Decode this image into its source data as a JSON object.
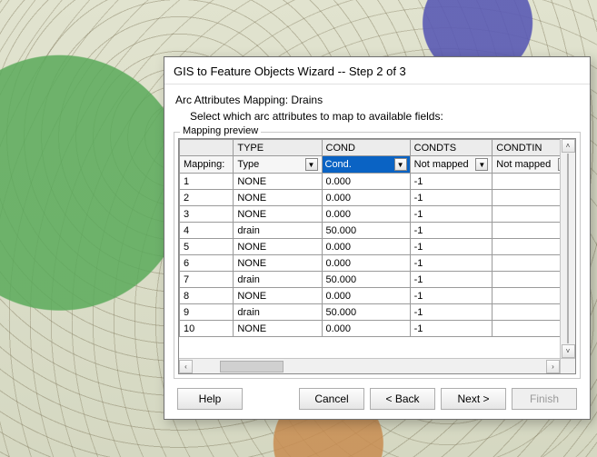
{
  "dialog": {
    "title": "GIS to Feature Objects Wizard -- Step 2 of 3",
    "section_label": "Arc Attributes Mapping:  Drains",
    "section_sub": "Select which arc attributes to map to available fields:",
    "fieldset_legend": "Mapping preview"
  },
  "columns": [
    "",
    "TYPE",
    "COND",
    "CONDTS",
    "CONDTIN"
  ],
  "mapping_row": {
    "label": "Mapping:",
    "cells": [
      {
        "value": "Type",
        "selected": false
      },
      {
        "value": "Cond.",
        "selected": true
      },
      {
        "value": "Not mapped",
        "selected": false
      },
      {
        "value": "Not mapped",
        "selected": false
      }
    ]
  },
  "rows": [
    {
      "n": "1",
      "type": "NONE",
      "cond": "0.000",
      "condts": "-1",
      "condtin": ""
    },
    {
      "n": "2",
      "type": "NONE",
      "cond": "0.000",
      "condts": "-1",
      "condtin": ""
    },
    {
      "n": "3",
      "type": "NONE",
      "cond": "0.000",
      "condts": "-1",
      "condtin": ""
    },
    {
      "n": "4",
      "type": "drain",
      "cond": "50.000",
      "condts": "-1",
      "condtin": ""
    },
    {
      "n": "5",
      "type": "NONE",
      "cond": "0.000",
      "condts": "-1",
      "condtin": ""
    },
    {
      "n": "6",
      "type": "NONE",
      "cond": "0.000",
      "condts": "-1",
      "condtin": ""
    },
    {
      "n": "7",
      "type": "drain",
      "cond": "50.000",
      "condts": "-1",
      "condtin": ""
    },
    {
      "n": "8",
      "type": "NONE",
      "cond": "0.000",
      "condts": "-1",
      "condtin": ""
    },
    {
      "n": "9",
      "type": "drain",
      "cond": "50.000",
      "condts": "-1",
      "condtin": ""
    },
    {
      "n": "10",
      "type": "NONE",
      "cond": "0.000",
      "condts": "-1",
      "condtin": ""
    }
  ],
  "buttons": {
    "help": "Help",
    "cancel": "Cancel",
    "back": "< Back",
    "next": "Next >",
    "finish": "Finish"
  }
}
